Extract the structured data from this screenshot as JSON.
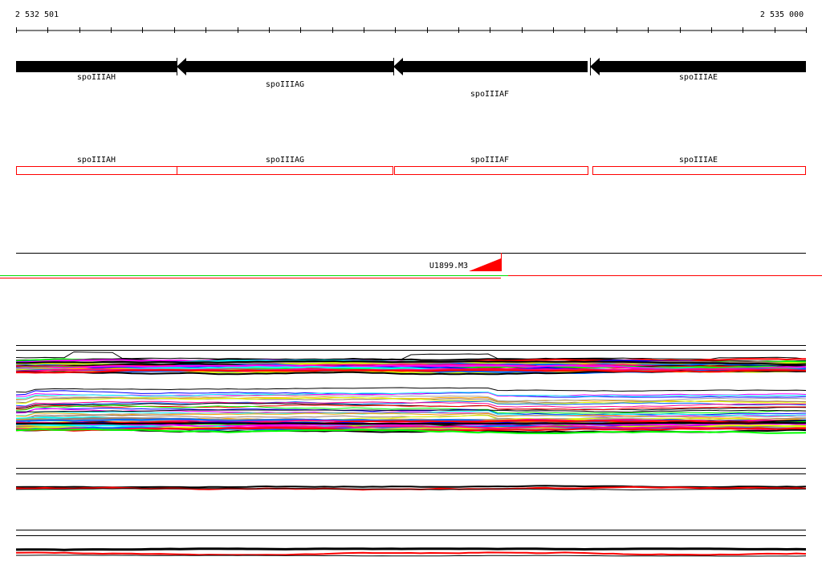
{
  "ruler": {
    "start_label": "2 532 501",
    "end_label": "2 535 000"
  },
  "genes": [
    {
      "name": "spoIIIAH",
      "strand": "+"
    },
    {
      "name": "spoIIIAG",
      "strand": "-"
    },
    {
      "name": "spoIIIAF",
      "strand": "-"
    },
    {
      "name": "spoIIIAE",
      "strand": "-"
    }
  ],
  "annotations": [
    {
      "name": "spoIIIAH"
    },
    {
      "name": "spoIIIAG"
    },
    {
      "name": "spoIIIAF"
    },
    {
      "name": "spoIIIAE"
    }
  ],
  "feature": {
    "label": "U1899.M3"
  },
  "colors": {
    "gene": "#000000",
    "annotation_box": "#ff0000",
    "feature": "#ff0000",
    "marker_green": "#00dd00",
    "palette": [
      "#000000",
      "#ff0000",
      "#00ff00",
      "#0000ff",
      "#ff00ff",
      "#00ffff",
      "#ffa500",
      "#a0a0a0",
      "#9a7b6b",
      "#ddff00",
      "#0066ff",
      "#ff0088"
    ]
  }
}
